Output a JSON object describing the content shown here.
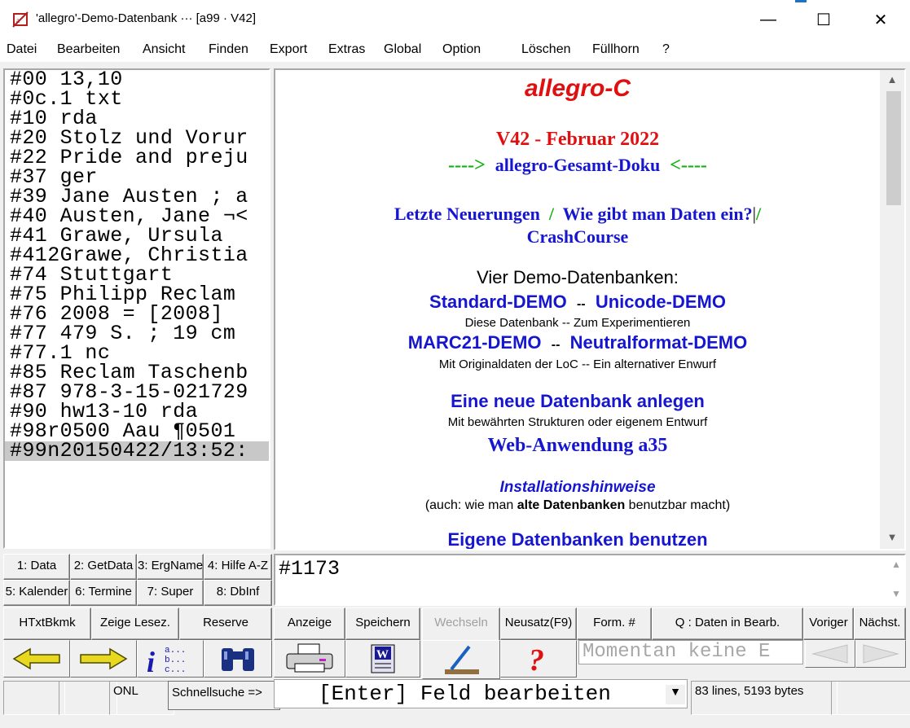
{
  "window": {
    "title": "'allegro'-Demo-Datenbank ··· [a99 · V42]",
    "app_icon": "allegro-app-icon",
    "controls": {
      "minimize": "—",
      "maximize": "☐",
      "close": "✕"
    }
  },
  "menu": [
    "Datei",
    "Bearbeiten",
    "Ansicht",
    "Finden",
    "Export",
    "Extras",
    "Global",
    "Option",
    "Löschen",
    "Füllhorn",
    "?"
  ],
  "record_lines": [
    "#00 13,10",
    "#0c.1 txt",
    "#10 rda",
    "#20 Stolz und Vorur",
    "#22 Pride and preju",
    "#37 ger",
    "#39 Jane Austen ; a",
    "#40 Austen, Jane ¬<",
    "#41 Grawe, Ursula",
    "#412Grawe, Christia",
    "#74 Stuttgart",
    "#75 Philipp Reclam",
    "#76 2008 = [2008]",
    "#77 479 S. ; 19 cm",
    "#77.1 nc",
    "#85 Reclam Taschenb",
    "#87 978-3-15-021729",
    "#90 hw13-10 rda",
    "#98r0500 Aau ¶0501",
    "#99n20150422/13:52:"
  ],
  "doc": {
    "title": "allegro-C",
    "version": "V42 - Februar 2022",
    "arrow_left": "---->",
    "gesamt_doku": "allegro-Gesamt-Doku",
    "arrow_right": "<----",
    "neuerungen": "Letzte Neuerungen",
    "sep1": "/",
    "daten_ein": "Wie gibt man Daten ein?",
    "sep2": "/",
    "crashcourse": "CrashCourse",
    "vier_demo": "Vier Demo-Datenbanken:",
    "standard_demo": "Standard-DEMO",
    "dash1": "--",
    "unicode_demo": "Unicode-DEMO",
    "diese_db": "Diese Datenbank  --  Zum Experimentieren",
    "marc_demo": "MARC21-DEMO",
    "dash2": "--",
    "neutral_demo": "Neutralformat-DEMO",
    "loc_line": "Mit Originaldaten der LoC  --  Ein alternativer Enwurf",
    "neue_db": "Eine neue Datenbank anlegen",
    "strukturen": "Mit bewährten Strukturen oder eigenem Entwurf",
    "web_app": "Web-Anwendung a35",
    "install": "Installationshinweise",
    "auch_pre": "(auch: wie man ",
    "auch_bold": "alte Datenbanken",
    "auch_post": " benutzbar macht)",
    "eigene_db": "Eigene Datenbanken benutzen"
  },
  "func_buttons_row1": [
    "1: Data",
    "2: GetData",
    "3: ErgName",
    "4: Hilfe A-Z"
  ],
  "func_buttons_row2": [
    "5: Kalender",
    "6: Termine",
    "7: Super",
    "8: DbInf"
  ],
  "command": "#1173",
  "action_buttons": {
    "htxt": "HTxtBkmk",
    "lesez": "Zeige Lesez.",
    "reserve": "Reserve",
    "anzeige": "Anzeige",
    "speichern": "Speichern",
    "wechseln": "Wechseln",
    "neusatz": "Neusatz(F9)",
    "form": "Form. #",
    "daten_bearb": "Q : Daten in Bearb.",
    "voriger": "Voriger",
    "naechst": "Nächst."
  },
  "message_field": "Momentan keine E",
  "status": {
    "onl": "ONL",
    "schnellsuche": "Schnellsuche =>",
    "command_hint": "[Enter] Feld bearbeiten",
    "size": "83 lines, 5193 bytes"
  },
  "colors": {
    "doc_blue": "#1616cf",
    "doc_red": "#e01010",
    "doc_green": "#10b010",
    "selection": "#c8c8c8"
  }
}
